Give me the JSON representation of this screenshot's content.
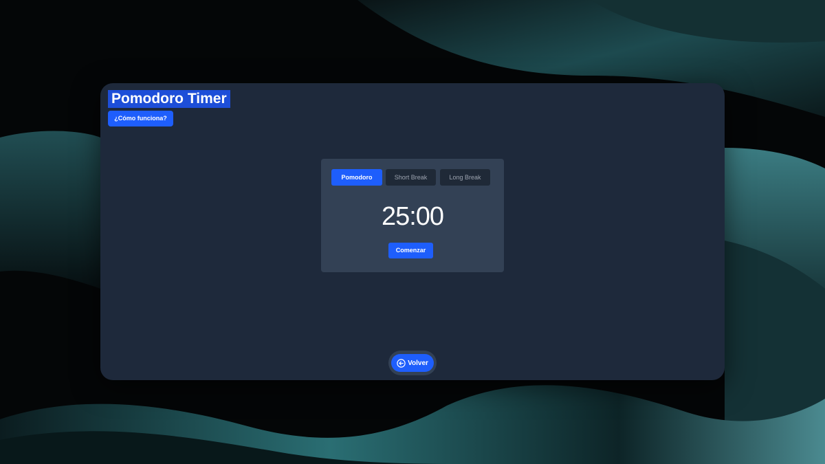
{
  "app": {
    "title": "Pomodoro Timer",
    "help_label": "¿Cómo funciona?"
  },
  "timer": {
    "tabs": [
      {
        "label": "Pomodoro",
        "active": true
      },
      {
        "label": "Short Break",
        "active": false
      },
      {
        "label": "Long Break",
        "active": false
      }
    ],
    "time": "25:00",
    "start_label": "Comenzar"
  },
  "nav": {
    "back_label": "Volver",
    "back_icon": "arrow-left-circle-icon"
  },
  "colors": {
    "accent": "#1e5efc",
    "window_bg": "#1e293b",
    "card_bg": "#334155",
    "tab_inactive_bg": "#1f2937",
    "title_highlight": "#1d4ed8"
  }
}
